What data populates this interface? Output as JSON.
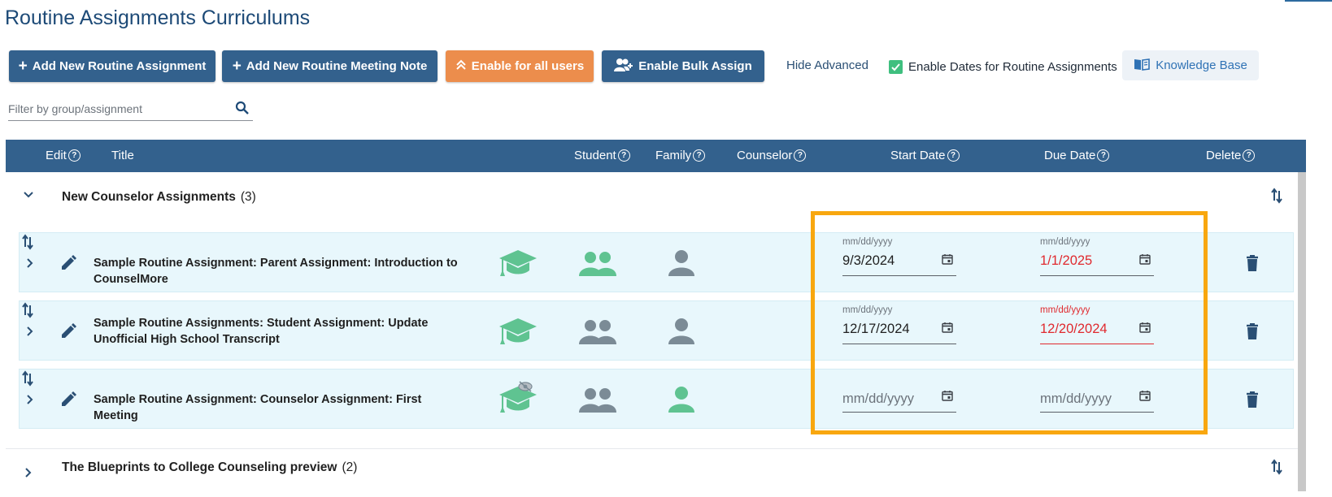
{
  "page": {
    "title": "Routine Assignments Curriculums"
  },
  "toolbar": {
    "add_assignment": "Add New Routine Assignment",
    "add_meeting_note": "Add New Routine Meeting Note",
    "enable_all": "Enable for all users",
    "enable_bulk": "Enable Bulk Assign",
    "hide_advanced": "Hide Advanced",
    "enable_dates_label": "Enable Dates for Routine Assignments",
    "enable_dates_checked": true,
    "knowledge_base": "Knowledge Base"
  },
  "filter": {
    "placeholder": "Filter by group/assignment",
    "value": ""
  },
  "table": {
    "headers": {
      "edit": "Edit",
      "title": "Title",
      "student": "Student",
      "family": "Family",
      "counselor": "Counselor",
      "start_date": "Start Date",
      "due_date": "Due Date",
      "delete": "Delete"
    }
  },
  "groups": [
    {
      "title": "New Counselor Assignments",
      "count": "(3)",
      "expanded": true,
      "assignments": [
        {
          "title": "Sample Routine Assignment: Parent Assignment: Introduction to CounselMore",
          "student_enabled": true,
          "family_enabled": true,
          "counselor_enabled": false,
          "start_label": "mm/dd/yyyy",
          "start_value": "9/3/2024",
          "due_label": "mm/dd/yyyy",
          "due_value": "1/1/2025"
        },
        {
          "title": "Sample Routine Assignments: Student Assignment: Update Unofficial High School Transcript",
          "student_enabled": true,
          "family_enabled": false,
          "counselor_enabled": false,
          "start_label": "mm/dd/yyyy",
          "start_value": "12/17/2024",
          "due_label": "mm/dd/yyyy",
          "due_value": "12/20/2024"
        },
        {
          "title": "Sample Routine Assignment: Counselor Assignment: First Meeting",
          "student_enabled": true,
          "family_enabled": false,
          "counselor_enabled": true,
          "start_placeholder": "mm/dd/yyyy",
          "due_placeholder": "mm/dd/yyyy"
        }
      ]
    },
    {
      "title": "The Blueprints to College Counseling preview",
      "count": "(2)",
      "expanded": false
    }
  ],
  "colors": {
    "primary": "#33618d",
    "orange": "#ec8d4c",
    "green": "#5fc391",
    "gray_icon": "#7b8b96",
    "error": "#e0292e",
    "highlight": "#f8a70f",
    "row_bg": "#e8f7fc"
  }
}
